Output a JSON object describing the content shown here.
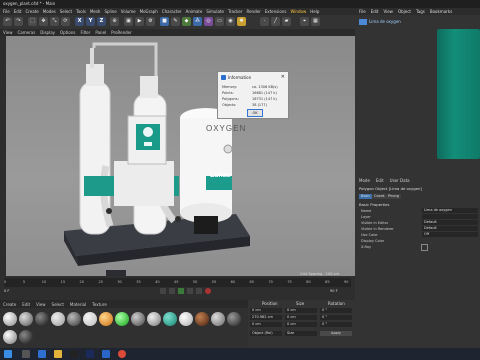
{
  "title": "oxygen_plant.c4d * - Main",
  "menu": [
    "File",
    "Edit",
    "Create",
    "Modes",
    "Select",
    "Tools",
    "Mesh",
    "Spline",
    "Volume",
    "MoGraph",
    "Character",
    "Animate",
    "Simulate",
    "Tracker",
    "Render",
    "Extensions",
    "Window",
    "Help"
  ],
  "menu_highlight": [
    "Window"
  ],
  "view_menu": [
    "View",
    "Cameras",
    "Display",
    "Options",
    "Filter",
    "Panel",
    "ProRender"
  ],
  "right_menu": [
    "File",
    "Edit",
    "View",
    "Object",
    "Tags",
    "Bookmarks"
  ],
  "objects_item": "Lima de oxygen",
  "info_dialog": {
    "title": "Information",
    "rows": [
      {
        "label": "Memory:",
        "value": "ca. 1306 KB(s)"
      },
      {
        "label": "Points:",
        "value": "16681 (147 k)"
      },
      {
        "label": "Polygons:",
        "value": "16731 (147 k)"
      },
      {
        "label": "Objects:",
        "value": "38 (177)"
      }
    ],
    "ok": "OK"
  },
  "grid_spacing": "Grid Spacing : 100 cm",
  "mat_menu": [
    "Create",
    "Edit",
    "View",
    "Select",
    "Material",
    "Texture"
  ],
  "coords": {
    "position": "Position",
    "size": "Size",
    "rotation": "Rotation",
    "x": "0 cm",
    "y": "270.982 cm",
    "z": "0 cm",
    "sx": "0 cm",
    "sy": "0 cm",
    "sz": "0 cm",
    "h": "0 °",
    "p": "0 °",
    "b": "0 °",
    "mode": "Object (Rel)",
    "size_mode": "Size",
    "apply": "Apply"
  },
  "attributes": {
    "menu": [
      "Mode",
      "Edit",
      "User Data"
    ],
    "header": "Polygon Object [Lima de oxygen]",
    "tabs": [
      "Basic",
      "Coord.",
      "Phong"
    ],
    "section": "Basic Properties",
    "rows": [
      {
        "label": "Name",
        "value": "Lima de oxygen"
      },
      {
        "label": "Layer",
        "value": ""
      },
      {
        "label": "Visible in Editor",
        "value": "Default"
      },
      {
        "label": "Visible in Renderer",
        "value": "Default"
      },
      {
        "label": "Use Color",
        "value": "Off"
      },
      {
        "label": "Display Color",
        "value": ""
      },
      {
        "label": "X-Ray",
        "value": ""
      }
    ]
  },
  "scene_labels": {
    "oxygen": "OXYGEN",
    "brand": "Lunas"
  },
  "timeline_ticks": [
    "0",
    "5",
    "10",
    "15",
    "20",
    "25",
    "30",
    "35",
    "40",
    "45",
    "50",
    "55",
    "60",
    "65",
    "70",
    "75",
    "80",
    "85",
    "90"
  ],
  "frames": {
    "start": "0 F",
    "end": "90 F"
  }
}
